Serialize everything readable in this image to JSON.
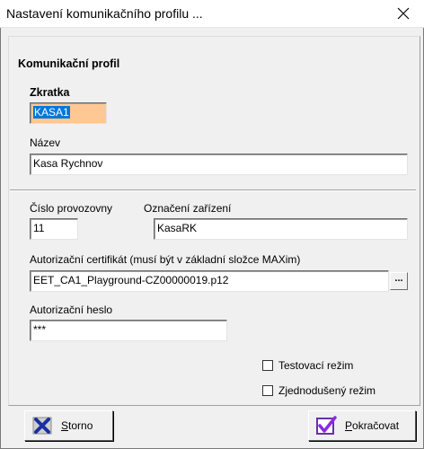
{
  "window": {
    "title": "Nastavení komunikačního profilu ...",
    "close_glyph": "✕"
  },
  "section_title": "Komunikační profil",
  "zkratka": {
    "label": "Zkratka",
    "value": "KASA1"
  },
  "nazev": {
    "label": "Název",
    "value": "Kasa Rychnov"
  },
  "cislo_provozovny": {
    "label": "Číslo provozovny",
    "value": "11"
  },
  "oznaceni_zarizeni": {
    "label": "Označení zařízení",
    "value": "KasaRK"
  },
  "certifikat": {
    "label": "Autorizační certifikát (musí být v základní složce MAXim)",
    "value": "EET_CA1_Playground-CZ00000019.p12",
    "browse_label": "..."
  },
  "heslo": {
    "label": "Autorizační heslo",
    "value": "***"
  },
  "options": {
    "testovaci": {
      "label": "Testovací režim",
      "checked": false
    },
    "zjednoduseny": {
      "label": "Zjednodušený režim",
      "checked": false
    }
  },
  "buttons": {
    "storno": {
      "accel": "S",
      "rest": "torno"
    },
    "pokracovat": {
      "accel": "P",
      "rest": "okračovat"
    }
  },
  "colors": {
    "zkratka_bg": "#fdc894",
    "selection": "#0078d7",
    "x_icon": "#1a2fa0"
  }
}
